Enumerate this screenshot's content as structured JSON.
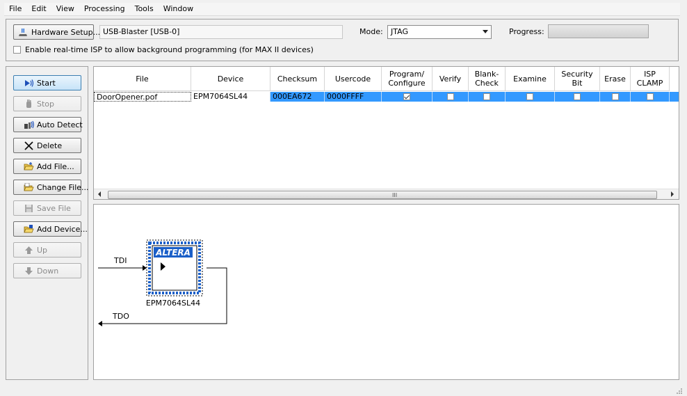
{
  "menu": [
    "File",
    "Edit",
    "View",
    "Processing",
    "Tools",
    "Window"
  ],
  "hardware": {
    "setup_label": "Hardware Setup...",
    "hardware_value": "USB-Blaster [USB-0]",
    "mode_label": "Mode:",
    "mode_value": "JTAG",
    "progress_label": "Progress:",
    "progress_percent": 0,
    "isp_checkbox_label": "Enable real-time ISP to allow background programming (for MAX II devices)",
    "isp_checked": false
  },
  "sidebar": {
    "start": "Start",
    "stop": "Stop",
    "auto_detect": "Auto Detect",
    "delete": "Delete",
    "add_file": "Add File...",
    "change_file": "Change File...",
    "save_file": "Save File",
    "add_device": "Add Device...",
    "up": "Up",
    "down": "Down"
  },
  "table": {
    "headers": [
      "File",
      "Device",
      "Checksum",
      "Usercode",
      "Program/\nConfigure",
      "Verify",
      "Blank-\nCheck",
      "Examine",
      "Security\nBit",
      "Erase",
      "ISP\nCLAMP"
    ],
    "row": {
      "file": "DoorOpener.pof",
      "device": "EPM7064SL44",
      "checksum": "000EA672",
      "usercode": "0000FFFF",
      "program_configure": true,
      "verify": false,
      "blank_check": false,
      "examine": false,
      "security_bit": false,
      "erase": false,
      "isp_clamp": false
    },
    "scroll_grip": "III"
  },
  "chain": {
    "tdi_label": "TDI",
    "tdo_label": "TDO",
    "device_name": "EPM7064SL44",
    "logo_text": "ALTERA"
  },
  "colors": {
    "selection": "#3399ff",
    "altera_blue": "#1a5fc8"
  }
}
